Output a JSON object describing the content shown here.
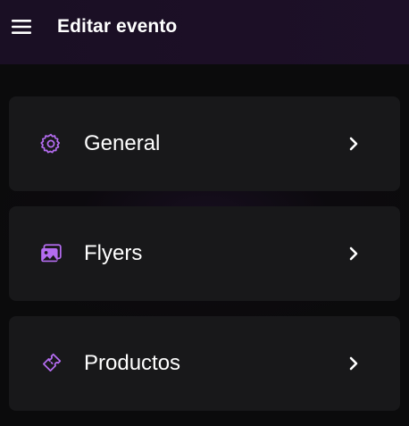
{
  "header": {
    "title": "Editar evento",
    "menu_icon": "hamburger-menu-icon"
  },
  "colors": {
    "accent": "#b46cf0",
    "header_bg": "#1c0f26",
    "card_bg": "#18181a",
    "page_bg": "#0b0b0c"
  },
  "sections": [
    {
      "label": "General",
      "icon": "gear-icon"
    },
    {
      "label": "Flyers",
      "icon": "images-icon"
    },
    {
      "label": "Productos",
      "icon": "ticket-icon"
    }
  ]
}
